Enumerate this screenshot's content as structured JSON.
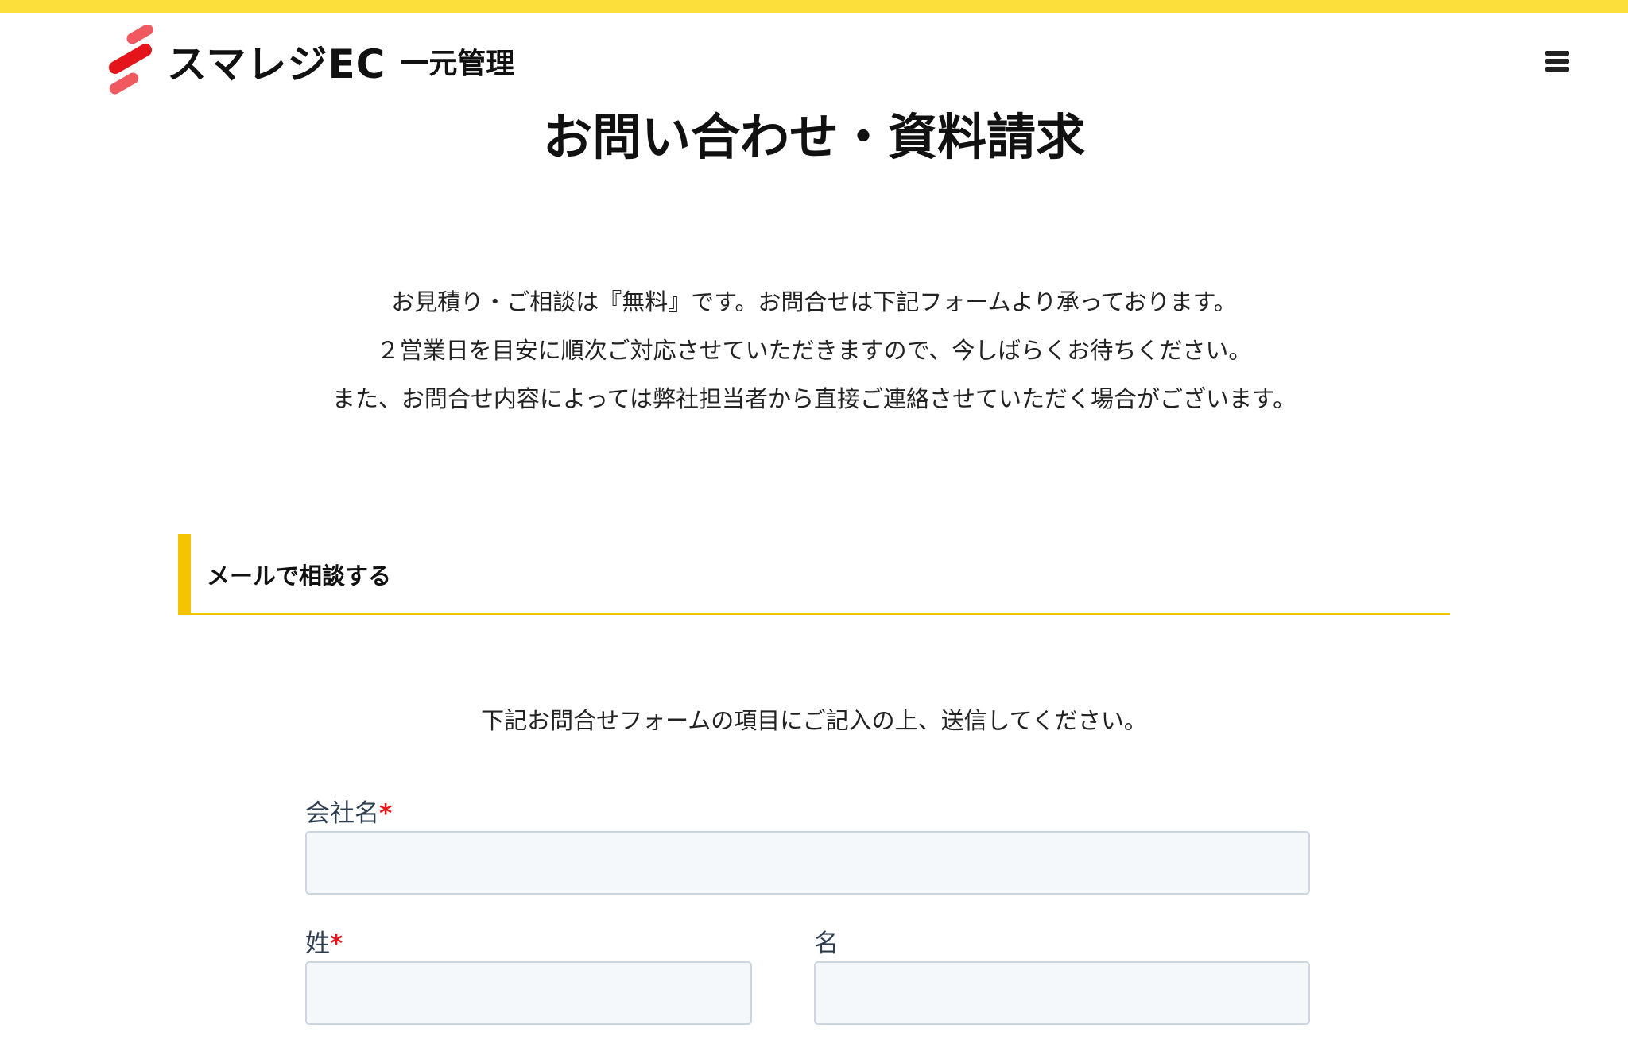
{
  "header": {
    "logo_text": "スマレジEC",
    "logo_sub": "一元管理",
    "colors": {
      "accent_yellow": "#fddf3c",
      "logo_red": "#e5141b"
    }
  },
  "page": {
    "title": "お問い合わせ・資料請求",
    "intro": [
      "お見積り・ご相談は『無料』です。お問合せは下記フォームより承っております。",
      "２営業日を目安に順次ご対応させていただきますので、今しばらくお待ちください。",
      "また、お問合せ内容によっては弊社担当者から直接ご連絡させていただく場合がございます。"
    ]
  },
  "section": {
    "title": "メールで相談する",
    "lead": "下記お問合せフォームの項目にご記入の上、送信してください。"
  },
  "form": {
    "required_mark": "*",
    "company": {
      "label": "会社名",
      "value": ""
    },
    "last_name": {
      "label": "姓",
      "value": ""
    },
    "first_name": {
      "label": "名",
      "value": ""
    }
  },
  "icons": {
    "menu": "hamburger-menu-icon",
    "logo": "smaregi-logo-mark"
  }
}
